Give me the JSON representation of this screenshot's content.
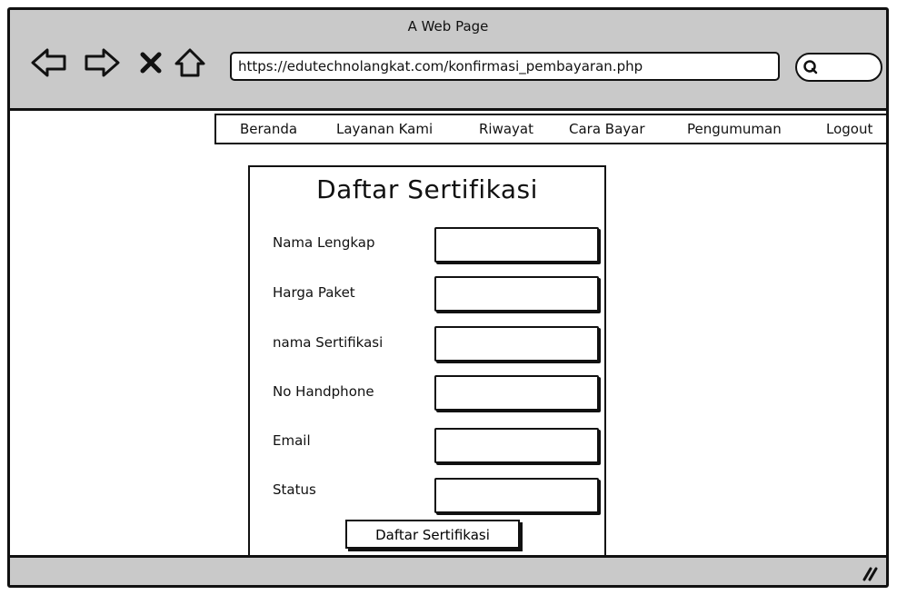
{
  "window": {
    "title": "A Web Page"
  },
  "browser": {
    "url": "https://edutechnolangkat.com/konfirmasi_pembayaran.php",
    "icons": [
      "back-arrow-icon",
      "forward-arrow-icon",
      "stop-icon",
      "home-icon",
      "search-icon"
    ]
  },
  "menu": {
    "items": [
      {
        "label": "Beranda"
      },
      {
        "label": "Layanan Kami"
      },
      {
        "label": "Riwayat"
      },
      {
        "label": "Cara Bayar"
      },
      {
        "label": "Pengumuman"
      },
      {
        "label": "Logout"
      }
    ]
  },
  "form": {
    "title": "Daftar Sertifikasi",
    "fields": [
      {
        "label": "Nama Lengkap",
        "value": ""
      },
      {
        "label": "Harga Paket",
        "value": ""
      },
      {
        "label": "nama Sertifikasi",
        "value": ""
      },
      {
        "label": "No Handphone",
        "value": ""
      },
      {
        "label": "Email",
        "value": ""
      },
      {
        "label": "Status",
        "value": ""
      }
    ],
    "submit_label": "Daftar Sertifikasi"
  },
  "colors": {
    "chrome": "#c9c9c9",
    "stroke": "#111111",
    "background": "#ffffff"
  }
}
